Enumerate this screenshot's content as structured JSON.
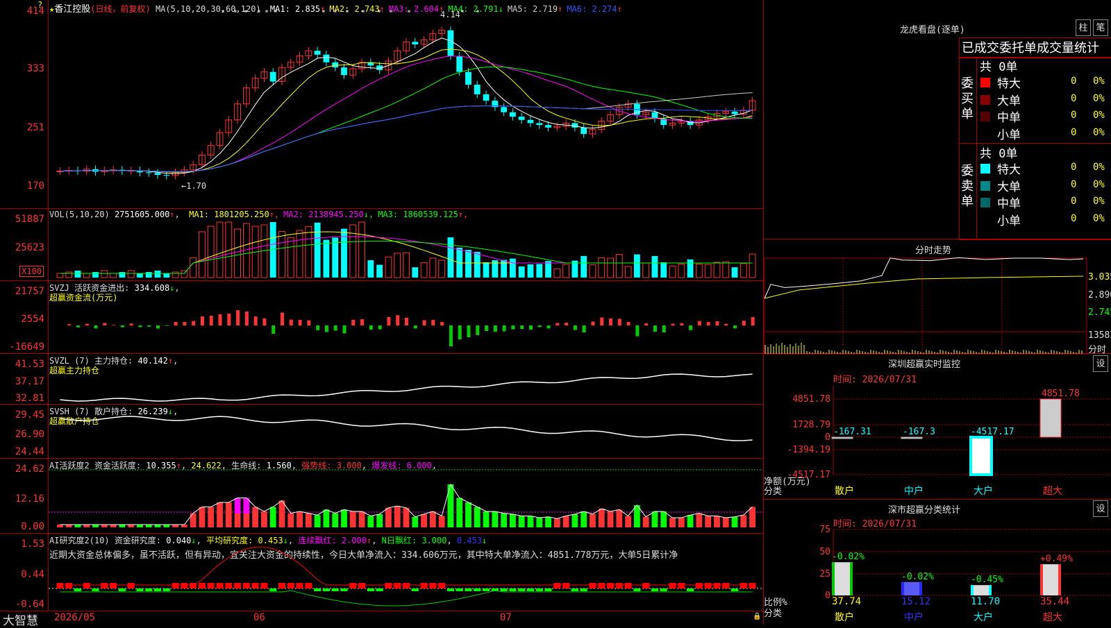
{
  "main_chart": {
    "star": "★",
    "stock_name": "香江控股",
    "period": "(日线，前复权)",
    "ma_label": "MA(5,10,20,30,60,120)",
    "ma_values": [
      {
        "name": "MA1",
        "value": "2.835",
        "arrow": "↑",
        "color": "#ffffff"
      },
      {
        "name": "MA2",
        "value": "2.743",
        "arrow": "↑",
        "color": "#ffff00"
      },
      {
        "name": "MA3",
        "value": "2.604",
        "arrow": "↑",
        "color": "#ff00ff"
      },
      {
        "name": "MA4",
        "value": "2.791",
        "arrow": "↓",
        "color": "#00ff00"
      },
      {
        "name": "MA5",
        "value": "2.719",
        "arrow": "↑",
        "color": "#cccccc"
      },
      {
        "name": "MA6",
        "value": "2.274",
        "arrow": "↑",
        "color": "#3355ff"
      }
    ],
    "y_labels": [
      "414",
      "333",
      "251",
      "170"
    ],
    "high_note": "4.14",
    "low_note": "←1.70"
  },
  "vol_panel": {
    "label": "VOL(5,10,20)",
    "value": "2751605.000",
    "ma": [
      {
        "name": "MA1",
        "value": "1801205.250",
        "arrow": "↑",
        "color": "#ffff00"
      },
      {
        "name": "MA2",
        "value": "2138945.250",
        "arrow": "↓",
        "color": "#ff00ff"
      },
      {
        "name": "MA3",
        "value": "1860539.125",
        "arrow": "↑",
        "color": "#00ff00"
      }
    ],
    "y_labels": [
      "51887",
      "25623"
    ],
    "unit": "X100"
  },
  "svzj_panel": {
    "label": "SVZJ 活跃资金进出:",
    "value": "334.608",
    "arrow": "↓",
    "sub": "超赢资金流(万元)",
    "y_labels": [
      "21757",
      "2554",
      "-16649"
    ]
  },
  "svzl_panel": {
    "label": "SVZL (7) 主力持仓:",
    "value": "40.142",
    "arrow": "↑",
    "sub": "超赢主力持仓",
    "y_labels": [
      "41.53",
      "37.17",
      "32.81"
    ]
  },
  "svsh_panel": {
    "label": "SVSH (7) 散户持仓:",
    "value": "26.239",
    "arrow": "↓",
    "sub": "超赢散户持仓",
    "y_labels": [
      "29.45",
      "26.90",
      "24.44"
    ]
  },
  "ai_active_panel": {
    "label": "AI活跃度2 资金活跃度:",
    "value1": "10.355",
    "value2": "24.622",
    "life_label": "生命线:",
    "life_value": "1.560",
    "strong_label": "强势线:",
    "strong_value": "3.000",
    "burst_label": "爆发线:",
    "burst_value": "6.000",
    "y_labels": [
      "24.62",
      "12.16",
      "0.00"
    ]
  },
  "ai_research_panel": {
    "label": "AI研究度2(10) 资金研究度:",
    "v1": "0.040",
    "avg_label": "平均研究度:",
    "v2": "0.453",
    "cont_label": "连续飘红:",
    "v3": "2.000",
    "n_label": "N日飘红:",
    "v4": "3.000",
    "v5": "0.453",
    "comment": "近期大资金总体偏多，虽不活跃，但有异动，宜关注大资金的持续性，今日大单净流入：334.606万元，其中特大单净流入：4851.778万元，大单5日累计净",
    "y_labels": [
      "1.53",
      "0.44",
      "-0.64"
    ]
  },
  "x_axis": {
    "brand": "大智慧",
    "labels": [
      "2026/05",
      "06",
      "07"
    ]
  },
  "dragon": {
    "title": "龙虎看盘(逐单)",
    "btn_bar": "柱",
    "btn_pen": "笔",
    "subtitle": "已成交委托单成交量统计",
    "buy_label": "委买单",
    "sell_label": "委卖单",
    "total": "共 0单",
    "buy_rows": [
      {
        "name": "特大",
        "color": "#ff0000",
        "qty": "0",
        "pct": "0%"
      },
      {
        "name": "大单",
        "color": "#880000",
        "qty": "0",
        "pct": "0%"
      },
      {
        "name": "中单",
        "color": "#550000",
        "qty": "0",
        "pct": "0%"
      },
      {
        "name": "小单",
        "color": "#000000",
        "qty": "0",
        "pct": "0%"
      }
    ],
    "sell_rows": [
      {
        "name": "特大",
        "color": "#00ffff",
        "qty": "0",
        "pct": "0%"
      },
      {
        "name": "大单",
        "color": "#008888",
        "qty": "0",
        "pct": "0%"
      },
      {
        "name": "中单",
        "color": "#006666",
        "qty": "0",
        "pct": "0%"
      },
      {
        "name": "小单",
        "color": "#000000",
        "qty": "0",
        "pct": "0%"
      }
    ]
  },
  "intraday": {
    "title": "分时走势",
    "y_labels": [
      "3.035",
      "2.890",
      "2.745"
    ],
    "vol_label": "13583",
    "vol_unit": "分时"
  },
  "monitor": {
    "title": "深圳超赢实时监控",
    "btn": "设",
    "time": "时间: 2026/07/31",
    "y_labels": [
      "4851.78",
      "1728.79",
      "0",
      "-1394.19",
      "-4517.17"
    ],
    "y_caption": "净额(万元)",
    "x_caption": "分类",
    "categories": [
      "散户",
      "中户",
      "大户",
      "超大"
    ],
    "values": [
      "-167.31",
      "-167.3",
      "-4517.17",
      "4851.78"
    ]
  },
  "classify": {
    "title": "深市超赢分类统计",
    "btn": "设",
    "time": "时间: 2026/07/31",
    "y_labels": [
      "75",
      "50",
      "25",
      "0"
    ],
    "y_caption": "比例%",
    "x_caption": "分类",
    "categories": [
      "散户",
      "中户",
      "大户",
      "超大"
    ],
    "pct_labels": [
      "-0.02%",
      "-0.02%",
      "-0.45%",
      "+0.49%"
    ],
    "values": [
      "37.74",
      "15.12",
      "11.70",
      "35.44"
    ]
  },
  "colors": {
    "up": "#ff3333",
    "down": "#00ffff",
    "grid": "#aa0000",
    "axis_text": "#ff3333"
  }
}
